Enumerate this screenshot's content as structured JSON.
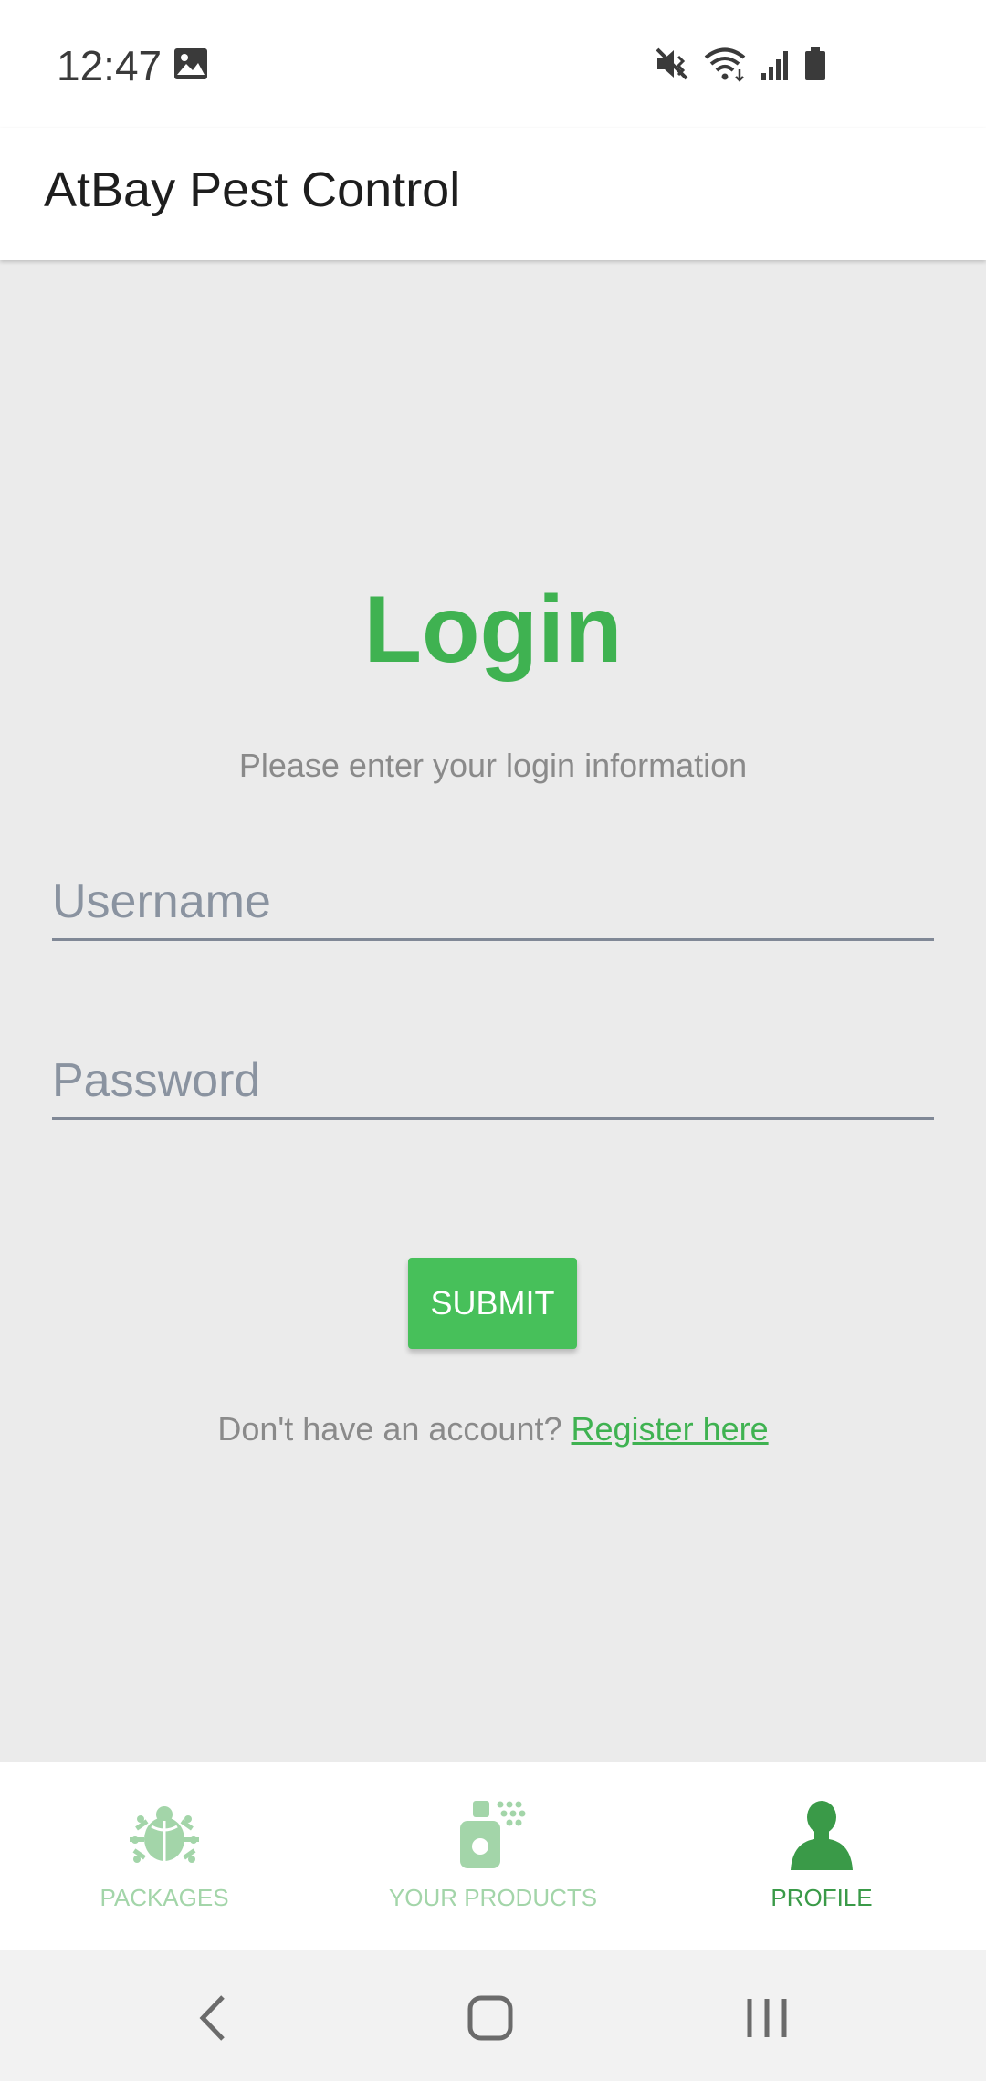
{
  "status_bar": {
    "time": "12:47",
    "icons": [
      "gallery-icon",
      "mute-icon",
      "wifi-icon",
      "signal-icon",
      "battery-icon"
    ]
  },
  "app_bar": {
    "title": "AtBay Pest Control"
  },
  "login": {
    "title": "Login",
    "subtitle": "Please enter your login information",
    "username_placeholder": "Username",
    "username_value": "",
    "password_placeholder": "Password",
    "password_value": "",
    "submit_label": "SUBMIT",
    "register_prompt": "Don't have an account?",
    "register_link": "Register here"
  },
  "bottom_nav": {
    "items": [
      {
        "label": "PACKAGES",
        "icon": "bug-icon",
        "active": false
      },
      {
        "label": "YOUR PRODUCTS",
        "icon": "spray-icon",
        "active": false
      },
      {
        "label": "PROFILE",
        "icon": "person-icon",
        "active": true
      }
    ]
  },
  "system_nav": {
    "buttons": [
      "back-icon",
      "home-icon",
      "recents-icon"
    ]
  },
  "colors": {
    "accent": "#3fb251",
    "submit_button": "#47c05a",
    "nav_inactive": "#a3d5a9",
    "nav_active": "#3a9a48",
    "background": "#ebebeb"
  }
}
